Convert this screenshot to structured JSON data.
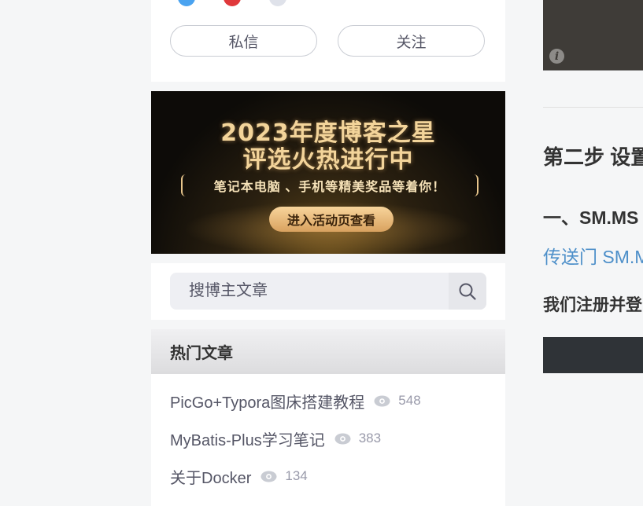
{
  "profile": {
    "message_button": "私信",
    "follow_button": "关注"
  },
  "banner": {
    "title_line1": "2023年度博客之星",
    "title_line2": "评选火热进行中",
    "subtitle": "笔记本电脑 、手机等精美奖品等着你！",
    "cta": "进入活动页查看"
  },
  "search": {
    "placeholder": "搜博主文章"
  },
  "hot_articles": {
    "header": "热门文章",
    "items": [
      {
        "title": "PicGo+Typora图床搭建教程",
        "views": "548"
      },
      {
        "title": "MyBatis-Plus学习笔记",
        "views": "383"
      },
      {
        "title": "关于Docker",
        "views": "134"
      }
    ]
  },
  "main": {
    "info_icon": "i",
    "heading_step": "第二步 设置",
    "heading_sub": "一、SM.MS",
    "link_text": "传送门 SM.MS",
    "bold_text": "我们注册并登"
  },
  "colors": {
    "page_bg": "#f5f6f7",
    "link": "#4d8fc9",
    "banner_gold": "#f3d49a"
  }
}
